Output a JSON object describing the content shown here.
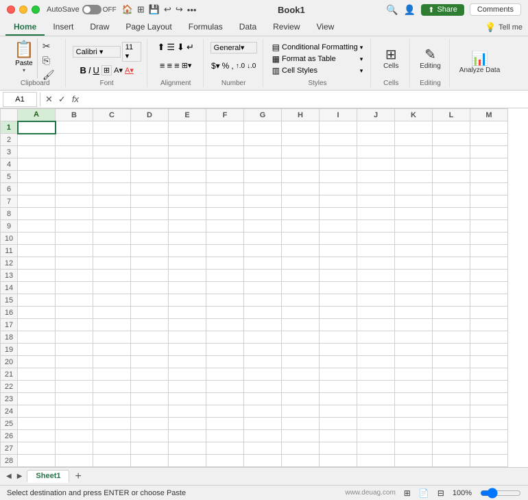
{
  "titleBar": {
    "title": "Book1",
    "autosave": "AutoSave",
    "autosave_state": "OFF"
  },
  "ribbon": {
    "tabs": [
      "Home",
      "Insert",
      "Draw",
      "Page Layout",
      "Formulas",
      "Data",
      "Review",
      "View"
    ],
    "active_tab": "Home",
    "tell_me": "Tell me",
    "groups": {
      "clipboard": {
        "label": "Paste",
        "paste_label": "Paste",
        "format_painter": "🖌"
      },
      "font": {
        "label": "Font"
      },
      "alignment": {
        "label": "Alignment"
      },
      "number": {
        "label": "Number"
      },
      "styles": {
        "conditional": "Conditional Formatting",
        "format_table": "Format as Table",
        "cell_styles": "Cell Styles"
      },
      "cells": {
        "label": "Cells"
      },
      "editing": {
        "label": "Editing"
      },
      "analyze": {
        "label": "Analyze Data"
      }
    }
  },
  "formulaBar": {
    "cell_ref": "A1",
    "fx": "fx"
  },
  "sheet": {
    "columns": [
      "A",
      "B",
      "C",
      "D",
      "E",
      "F",
      "G",
      "H",
      "I",
      "J",
      "K",
      "L",
      "M"
    ],
    "rows": 28,
    "active_cell": "A1"
  },
  "bottomBar": {
    "sheet_name": "Sheet1",
    "add_sheet_label": "+"
  },
  "statusBar": {
    "message": "Select destination and press ENTER or choose Paste",
    "zoom": "100%",
    "site": "www.deuag.com"
  },
  "actions": {
    "share_label": "Share",
    "comments_label": "Comments"
  }
}
